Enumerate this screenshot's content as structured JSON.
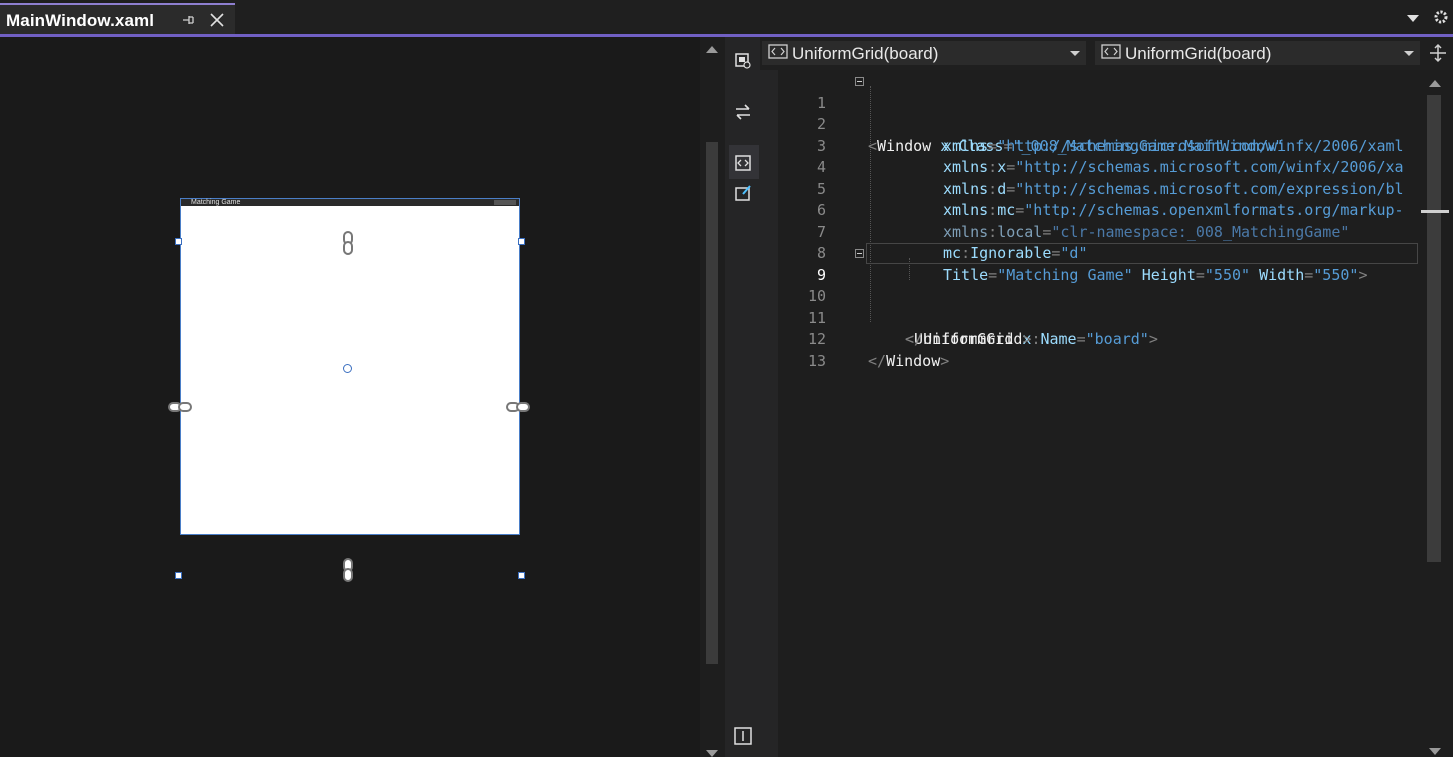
{
  "tab": {
    "title": "MainWindow.xaml"
  },
  "designer": {
    "window_title": "Matching Game"
  },
  "editor": {
    "left_combo": "UniformGrid(board)",
    "right_combo": "UniformGrid(board)",
    "current_line": 9,
    "lines": [
      {
        "n": "1",
        "text": "<Window x:Class=\"_008_MatchingGame.MainWindow\""
      },
      {
        "n": "2",
        "text": "xmlns=\"http://schemas.microsoft.com/winfx/2006/xaml"
      },
      {
        "n": "3",
        "text": "xmlns:x=\"http://schemas.microsoft.com/winfx/2006/xa"
      },
      {
        "n": "4",
        "text": "xmlns:d=\"http://schemas.microsoft.com/expression/bl"
      },
      {
        "n": "5",
        "text": "xmlns:mc=\"http://schemas.openxmlformats.org/markup-"
      },
      {
        "n": "6",
        "text": "xmlns:local=\"clr-namespace:_008_MatchingGame\""
      },
      {
        "n": "7",
        "text": "mc:Ignorable=\"d\""
      },
      {
        "n": "8",
        "text": "Title=\"Matching Game\" Height=\"550\" Width=\"550\">"
      },
      {
        "n": "9",
        "text": "<UniformGrid x:Name=\"board\">"
      },
      {
        "n": "10",
        "text": ""
      },
      {
        "n": "11",
        "text": "</UniformGrid>"
      },
      {
        "n": "12",
        "text": "</Window>"
      },
      {
        "n": "13",
        "text": ""
      }
    ]
  },
  "colors": {
    "accent": "#7160c4",
    "tag": "#f0f0f0",
    "attribute": "#9cdcfe",
    "value": "#569cd6",
    "selection_border": "#3b6fc0"
  },
  "icons": {
    "tab": [
      "pin-icon",
      "close-icon",
      "dropdown-icon",
      "gear-icon"
    ],
    "toolbar": [
      "design-view-icon",
      "swap-panes-icon",
      "xaml-view-icon",
      "edit-designer-icon",
      "split-toggle-icon"
    ],
    "combo": "code-tag-icon"
  }
}
